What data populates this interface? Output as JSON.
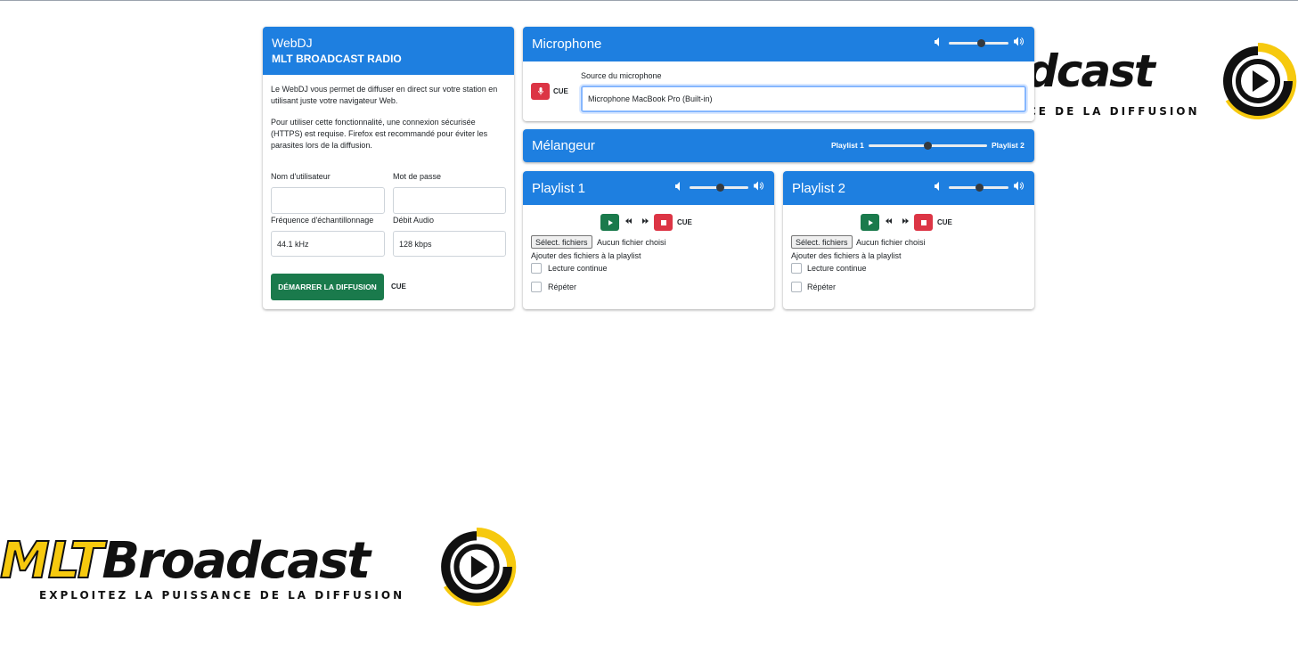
{
  "brand": {
    "logo_word": "MLTBroadcast",
    "logo_word_right": "dcast",
    "tagline": "EXPLOITEZ LA PUISSANCE DE LA DIFFUSION",
    "tagline_right": "CE DE LA DIFFUSION",
    "colors": {
      "yellow": "#f6c90e",
      "black": "#111111"
    }
  },
  "webdj": {
    "title": "WebDJ",
    "subtitle": "MLT BROADCAST RADIO",
    "desc1": "Le WebDJ vous permet de diffuser en direct sur votre station en utilisant juste votre navigateur Web.",
    "desc2": "Pour utiliser cette fonctionnalité, une connexion sécurisée (HTTPS) est requise. Firefox est recommandé pour éviter les parasites lors de la diffusion.",
    "username_label": "Nom d'utilisateur",
    "username_value": "",
    "password_label": "Mot de passe",
    "password_value": "",
    "samplerate_label": "Fréquence d'échantillonnage",
    "samplerate_value": "44.1 kHz",
    "bitrate_label": "Débit Audio",
    "bitrate_value": "128 kbps",
    "start_button": "DÉMARRER LA DIFFUSION",
    "cue_label": "CUE"
  },
  "microphone": {
    "title": "Microphone",
    "volume": 0.55,
    "cue_label": "CUE",
    "source_label": "Source du microphone",
    "source_value": "Microphone MacBook Pro (Built-in)"
  },
  "mixer": {
    "title": "Mélangeur",
    "left_label": "Playlist 1",
    "right_label": "Playlist 2",
    "position": 0.5
  },
  "playlists": [
    {
      "title": "Playlist 1",
      "volume": 0.52,
      "cue_label": "CUE",
      "file_button": "Sélect. fichiers",
      "file_status": "Aucun fichier choisi",
      "add_files_label": "Ajouter des fichiers à la playlist",
      "continuous_label": "Lecture continue",
      "repeat_label": "Répéter"
    },
    {
      "title": "Playlist 2",
      "volume": 0.52,
      "cue_label": "CUE",
      "file_button": "Sélect. fichiers",
      "file_status": "Aucun fichier choisi",
      "add_files_label": "Ajouter des fichiers à la playlist",
      "continuous_label": "Lecture continue",
      "repeat_label": "Répéter"
    }
  ],
  "icons": {
    "volume_low": "volume-low-icon",
    "volume_high": "volume-high-icon",
    "mic": "microphone-icon",
    "play": "play-icon",
    "rewind": "rewind-icon",
    "forward": "fast-forward-icon",
    "stop": "stop-icon"
  },
  "colors": {
    "header_blue": "#1e7fe0",
    "start_green": "#1a7a4c",
    "danger_red": "#dc3545"
  }
}
